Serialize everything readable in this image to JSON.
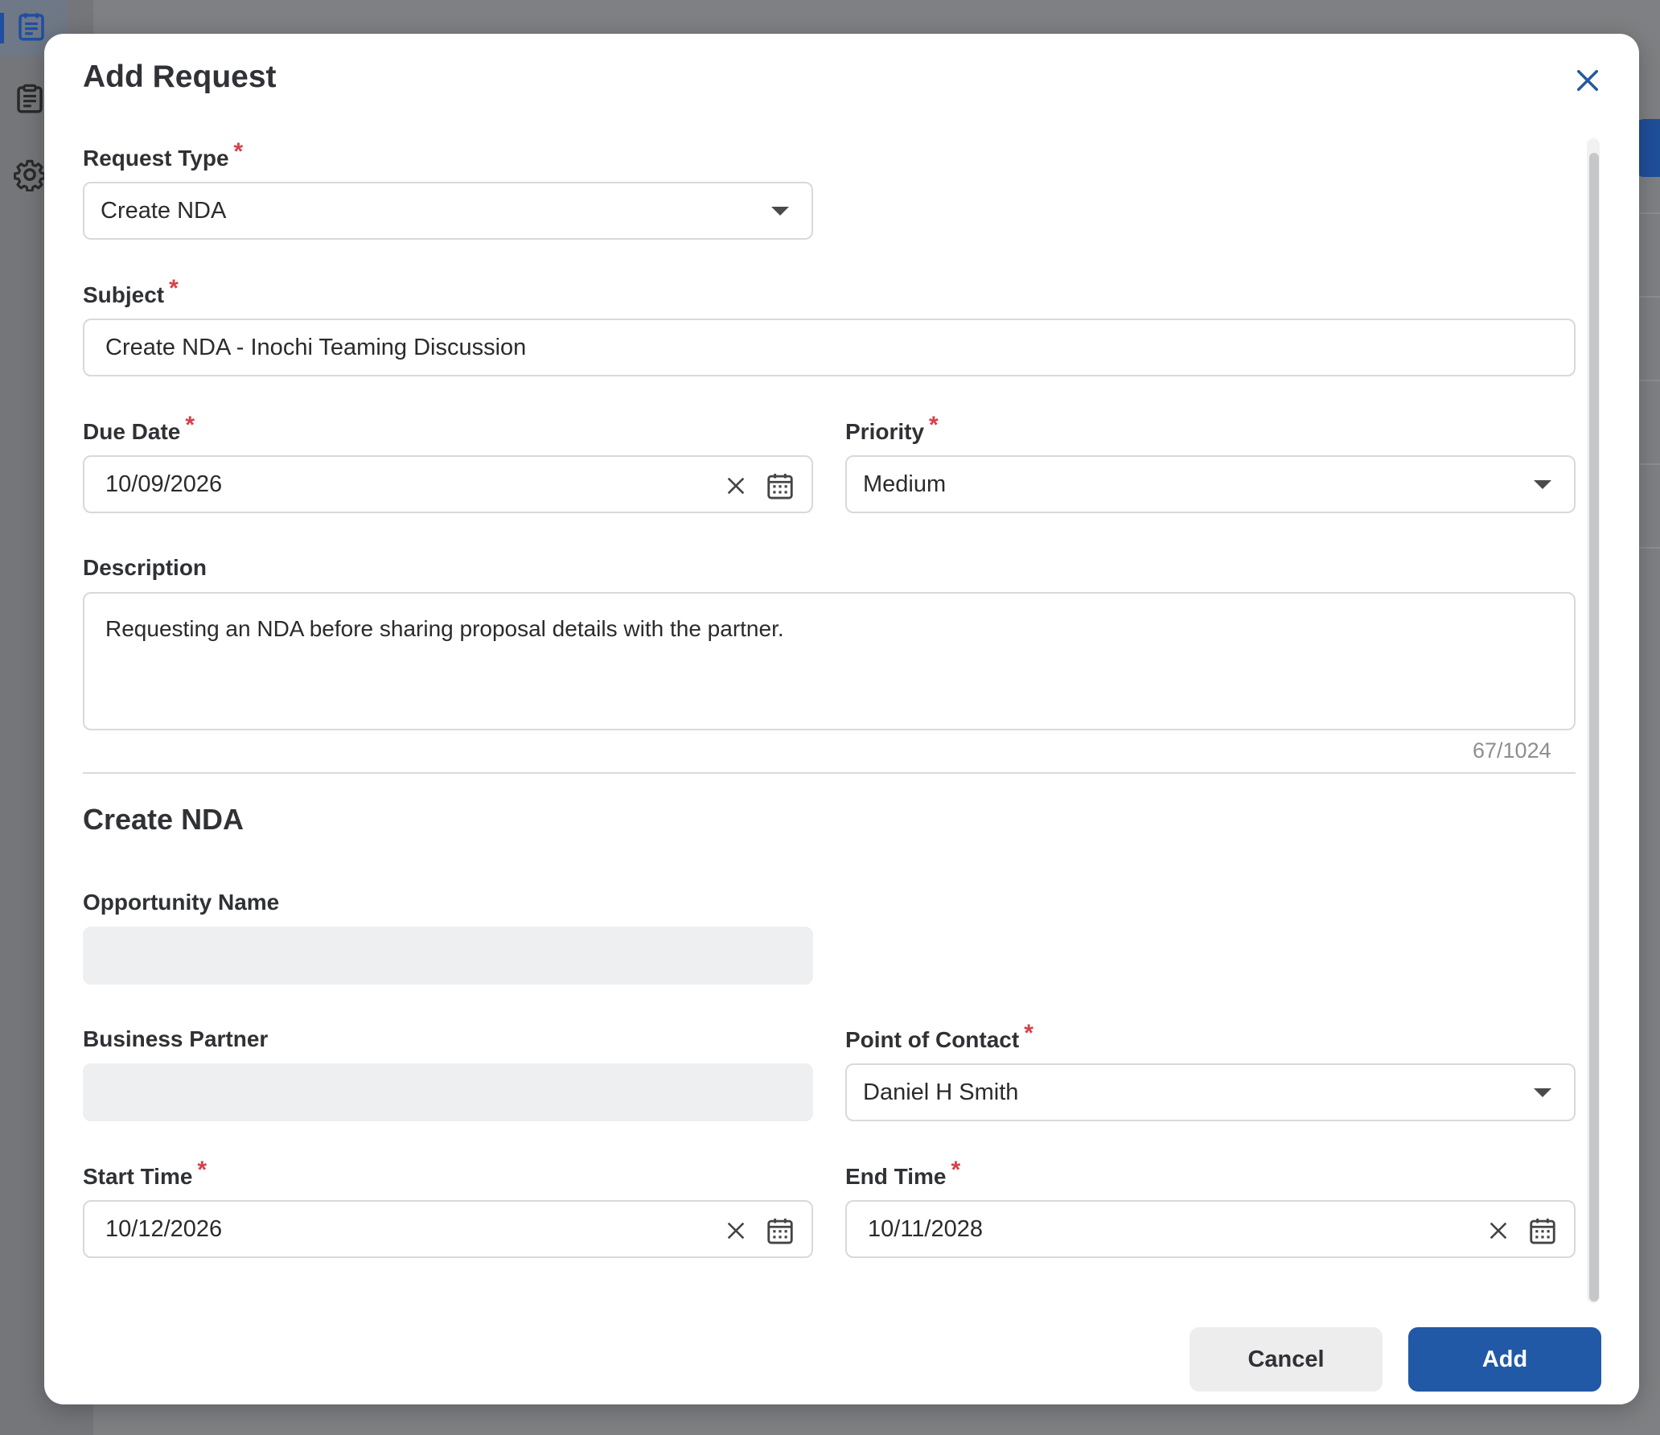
{
  "modal": {
    "title": "Add Request",
    "close_icon": "close-icon"
  },
  "form": {
    "request_type": {
      "label": "Request Type",
      "required": "*",
      "value": "Create NDA"
    },
    "subject": {
      "label": "Subject",
      "required": "*",
      "value": "Create NDA - Inochi Teaming Discussion"
    },
    "due_date": {
      "label": "Due Date",
      "required": "*",
      "value": "10/09/2026"
    },
    "priority": {
      "label": "Priority",
      "required": "*",
      "value": "Medium"
    },
    "description": {
      "label": "Description",
      "value": "Requesting an NDA before sharing proposal details with the partner.",
      "counter": "67/1024"
    }
  },
  "nda_section": {
    "title": "Create NDA",
    "opportunity_name": {
      "label": "Opportunity Name",
      "value": ""
    },
    "business_partner": {
      "label": "Business Partner",
      "value": ""
    },
    "point_of_contact": {
      "label": "Point of Contact",
      "required": "*",
      "value": "Daniel H Smith"
    },
    "start_time": {
      "label": "Start Time",
      "required": "*",
      "value": "10/12/2026"
    },
    "end_time": {
      "label": "End Time",
      "required": "*",
      "value": "10/11/2028"
    }
  },
  "actions": {
    "cancel_label": "Cancel",
    "add_label": "Add"
  },
  "colors": {
    "accent": "#2259a6",
    "required": "#d6404a",
    "overlay": "#7d7f82"
  }
}
